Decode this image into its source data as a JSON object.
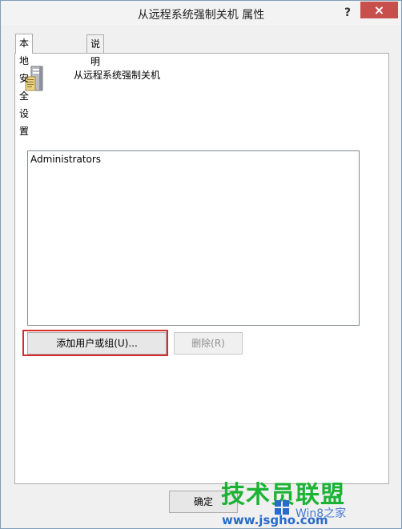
{
  "window": {
    "title": "从远程系统强制关机 属性",
    "help": "?",
    "close": "×"
  },
  "tabs": [
    {
      "label": "本地安全设置",
      "active": true
    },
    {
      "label": "说明",
      "active": false
    }
  ],
  "policy": {
    "name": "从远程系统强制关机",
    "icon": "server-icon"
  },
  "users": [
    "Administrators"
  ],
  "buttons": {
    "add": "添加用户或组(U)...",
    "remove": "删除(R)",
    "ok": "确定"
  },
  "watermark": {
    "main": "技术员联盟",
    "sub": "Win8之家",
    "url": "www.jsgho.com"
  },
  "colors": {
    "highlight": "#d62b2b",
    "close": "#c7504c",
    "watermark_green": "#1cb335",
    "watermark_blue": "#2a6ac8"
  }
}
